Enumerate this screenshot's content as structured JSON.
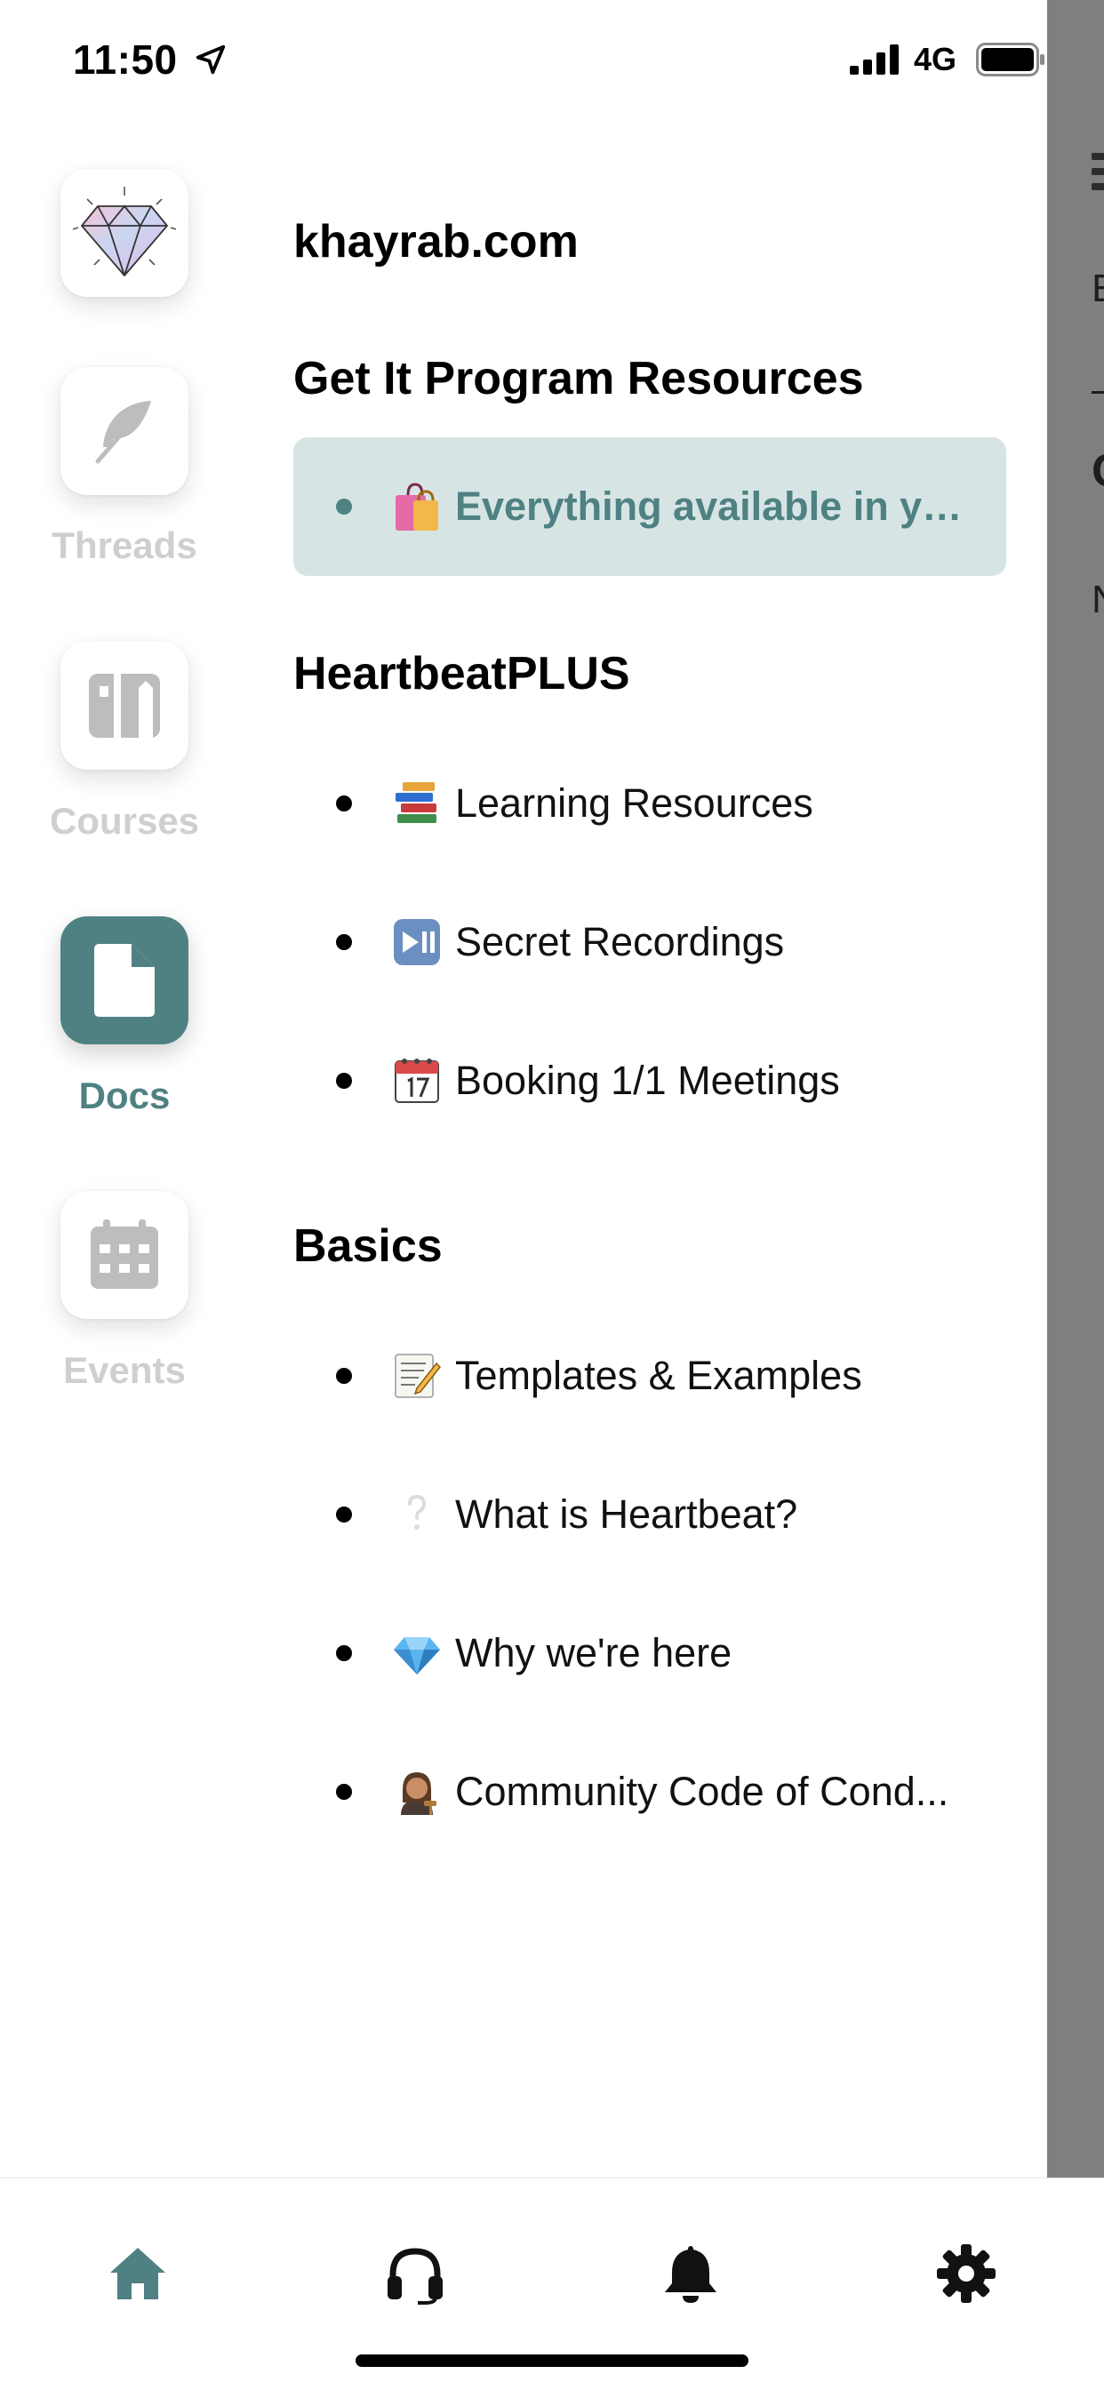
{
  "status_bar": {
    "time": "11:50",
    "network": "4G"
  },
  "underlay": {
    "fragments": [
      "E",
      "C",
      "N"
    ]
  },
  "workspace": {
    "title": "khayrab.com"
  },
  "rail": {
    "items": [
      {
        "label": "Threads",
        "icon": "feather-icon",
        "active": false
      },
      {
        "label": "Courses",
        "icon": "course-icon",
        "active": false
      },
      {
        "label": "Docs",
        "icon": "document-icon",
        "active": true
      },
      {
        "label": "Events",
        "icon": "calendar-icon",
        "active": false
      }
    ]
  },
  "sections": [
    {
      "title": "Get It Program Resources",
      "items": [
        {
          "emoji": "shopping-bags-icon",
          "label": "Everything available in yo...",
          "selected": true
        }
      ]
    },
    {
      "title": "HeartbeatPLUS",
      "items": [
        {
          "emoji": "books-icon",
          "label": "Learning Resources",
          "selected": false
        },
        {
          "emoji": "play-pause-icon",
          "label": "Secret Recordings",
          "selected": false
        },
        {
          "emoji": "calendar-17-icon",
          "label": "Booking 1/1 Meetings",
          "selected": false
        }
      ]
    },
    {
      "title": "Basics",
      "items": [
        {
          "emoji": "memo-icon",
          "label": "Templates & Examples",
          "selected": false
        },
        {
          "emoji": "white-question-icon",
          "label": "What is Heartbeat?",
          "selected": false
        },
        {
          "emoji": "gem-icon",
          "label": "Why we're here",
          "selected": false
        },
        {
          "emoji": "woman-judge-icon",
          "label": "Community Code of Cond...",
          "selected": false
        }
      ]
    }
  ],
  "tab_bar": {
    "items": [
      {
        "icon": "home-icon",
        "active": true
      },
      {
        "icon": "headphones-icon",
        "active": false
      },
      {
        "icon": "bell-icon",
        "active": false
      },
      {
        "icon": "gear-icon",
        "active": false
      }
    ]
  },
  "colors": {
    "accent": "#4f8183",
    "selected_bg": "#d6e5e4",
    "inactive_rail_label": "#cfcfcf",
    "underlay": "#7f7f7f"
  }
}
